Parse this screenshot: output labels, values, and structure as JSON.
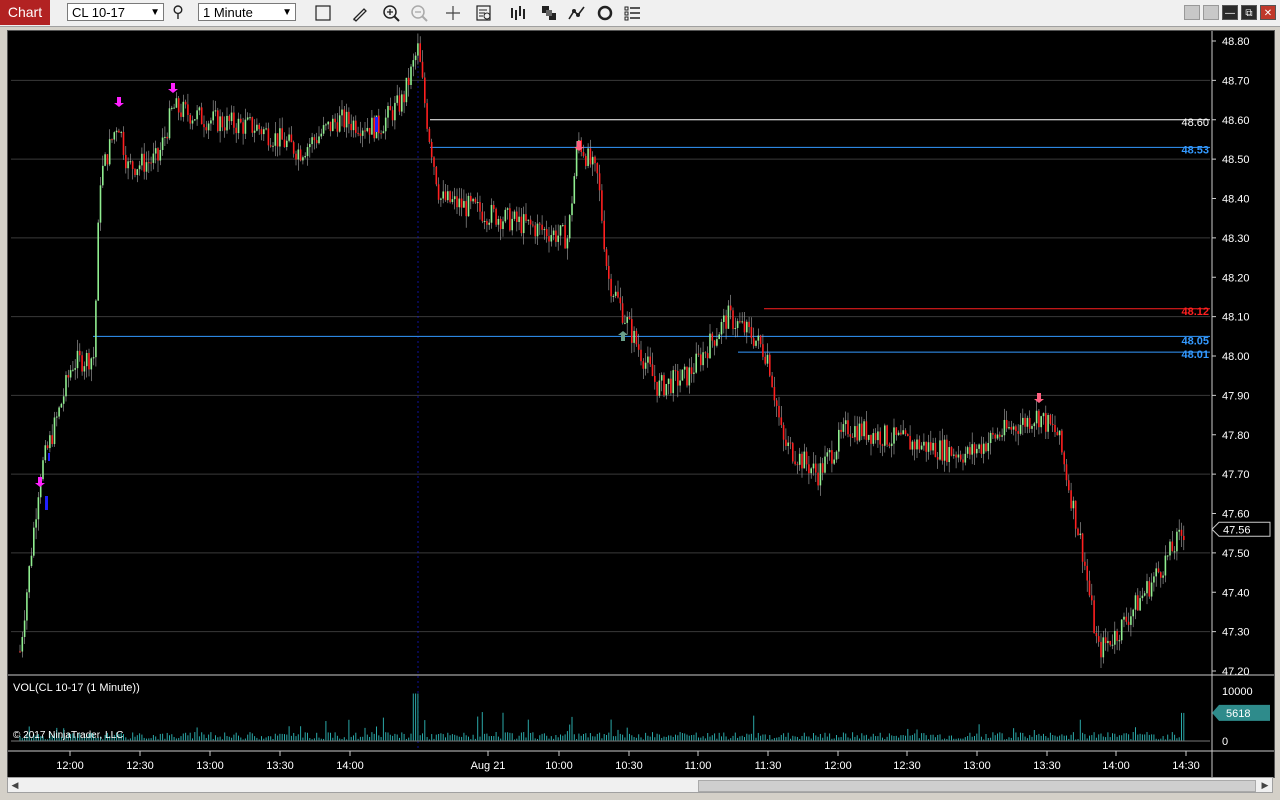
{
  "toolbar": {
    "tab_label": "Chart",
    "instrument": "CL 10-17",
    "interval": "1 Minute"
  },
  "price_axis": {
    "ticks": [
      "48.80",
      "48.70",
      "48.60",
      "48.50",
      "48.40",
      "48.30",
      "48.20",
      "48.10",
      "48.00",
      "47.90",
      "47.80",
      "47.70",
      "47.60",
      "47.50",
      "47.40",
      "47.30",
      "47.20"
    ],
    "current_price": "47.56",
    "levels": [
      {
        "label": "48.60",
        "color": "#ffffff"
      },
      {
        "label": "48.53",
        "color": "#3399ff"
      },
      {
        "label": "48.12",
        "color": "#ff2020"
      },
      {
        "label": "48.05",
        "color": "#3399ff"
      },
      {
        "label": "48.01",
        "color": "#3399ff"
      }
    ]
  },
  "volume_panel": {
    "title": "VOL(CL 10-17 (1 Minute))",
    "ticks": [
      "10000",
      "5000",
      "0"
    ],
    "current_value": "5618",
    "copyright": "© 2017 NinjaTrader, LLC"
  },
  "time_axis": {
    "labels": [
      "12:00",
      "12:30",
      "13:00",
      "13:30",
      "14:00",
      "Aug 21",
      "10:00",
      "10:30",
      "11:00",
      "11:30",
      "12:00",
      "12:30",
      "13:00",
      "13:30",
      "14:00",
      "14:30"
    ]
  },
  "colors": {
    "up_candle": "#90ee90",
    "down_candle": "#ff2020",
    "volume": "#2aa8a8",
    "current_badge": "#2e8b8b"
  },
  "chart_data": {
    "type": "candlestick",
    "instrument": "CL 10-17",
    "interval": "1 Minute",
    "ylim": [
      47.2,
      48.8
    ],
    "close_path": [
      [
        "11:40",
        47.25
      ],
      [
        "11:45",
        47.7
      ],
      [
        "11:50",
        47.85
      ],
      [
        "11:58",
        47.98
      ],
      [
        "12:05",
        48.0
      ],
      [
        "12:10",
        48.45
      ],
      [
        "12:18",
        48.6
      ],
      [
        "12:25",
        48.48
      ],
      [
        "12:35",
        48.5
      ],
      [
        "12:45",
        48.63
      ],
      [
        "13:00",
        48.6
      ],
      [
        "13:20",
        48.58
      ],
      [
        "13:30",
        48.52
      ],
      [
        "13:45",
        48.6
      ],
      [
        "14:00",
        48.58
      ],
      [
        "14:10",
        48.65
      ],
      [
        "14:15",
        48.78
      ],
      [
        "Aug 21 09:30",
        48.58
      ],
      [
        "09:35",
        48.4
      ],
      [
        "09:50",
        48.37
      ],
      [
        "10:05",
        48.3
      ],
      [
        "10:10",
        48.55
      ],
      [
        "10:18",
        48.45
      ],
      [
        "10:25",
        48.2
      ],
      [
        "10:35",
        48.05
      ],
      [
        "10:45",
        47.92
      ],
      [
        "10:55",
        47.95
      ],
      [
        "11:05",
        48.1
      ],
      [
        "11:15",
        48.05
      ],
      [
        "11:25",
        48.0
      ],
      [
        "11:35",
        47.78
      ],
      [
        "11:50",
        47.7
      ],
      [
        "12:00",
        47.82
      ],
      [
        "12:30",
        47.78
      ],
      [
        "13:00",
        47.75
      ],
      [
        "13:15",
        47.8
      ],
      [
        "13:30",
        47.85
      ],
      [
        "13:45",
        47.8
      ],
      [
        "13:55",
        47.5
      ],
      [
        "14:05",
        47.25
      ],
      [
        "14:15",
        47.3
      ],
      [
        "14:25",
        47.45
      ],
      [
        "14:30",
        47.56
      ]
    ],
    "volume_ylim": [
      0,
      10000
    ],
    "volume_last": 5618
  }
}
